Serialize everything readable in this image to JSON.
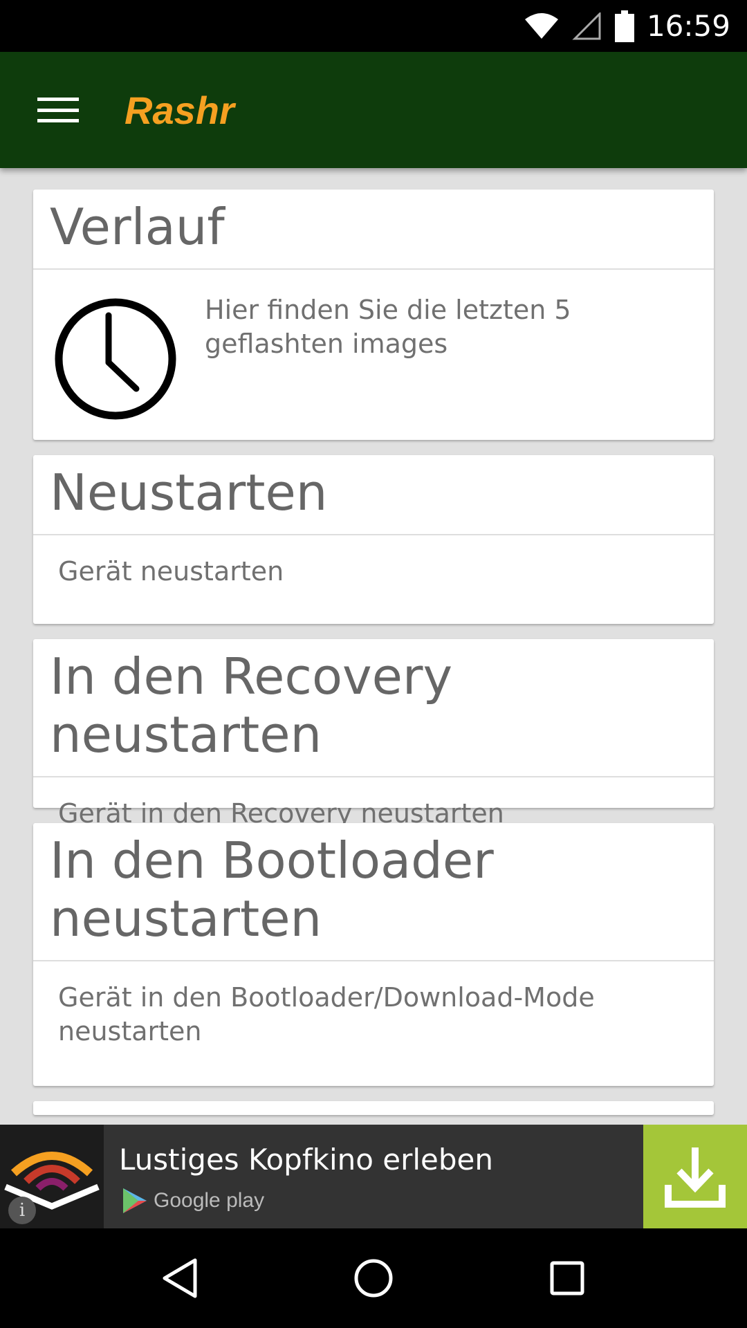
{
  "status_bar": {
    "time": "16:59",
    "icons": [
      "wifi-icon",
      "cell-signal-icon",
      "battery-icon"
    ]
  },
  "app_bar": {
    "menu_icon": "hamburger-menu-icon",
    "title": "Rashr"
  },
  "colors": {
    "app_bar": "#0e3c0c",
    "title": "#f5a021",
    "background": "#e0e0e0",
    "ad_download": "#a4c639"
  },
  "cards": [
    {
      "title": "Verlauf",
      "icon": "clock-icon",
      "description": "Hier finden Sie die letzten 5 geflashten images"
    },
    {
      "title": "Neustarten",
      "description": "Gerät neustarten"
    },
    {
      "title": "In den Recovery neustarten",
      "description": "Gerät in den Recovery neustarten"
    },
    {
      "title": "In den Bootloader neustarten",
      "description": "Gerät in den Bootloader/Download-Mode neustarten"
    }
  ],
  "ad": {
    "headline": "Lustiges Kopfkino erleben",
    "store": "Google play",
    "info": "i",
    "download_icon": "download-icon"
  },
  "nav_bar": {
    "buttons": [
      "back-icon",
      "home-icon",
      "recents-icon"
    ]
  }
}
